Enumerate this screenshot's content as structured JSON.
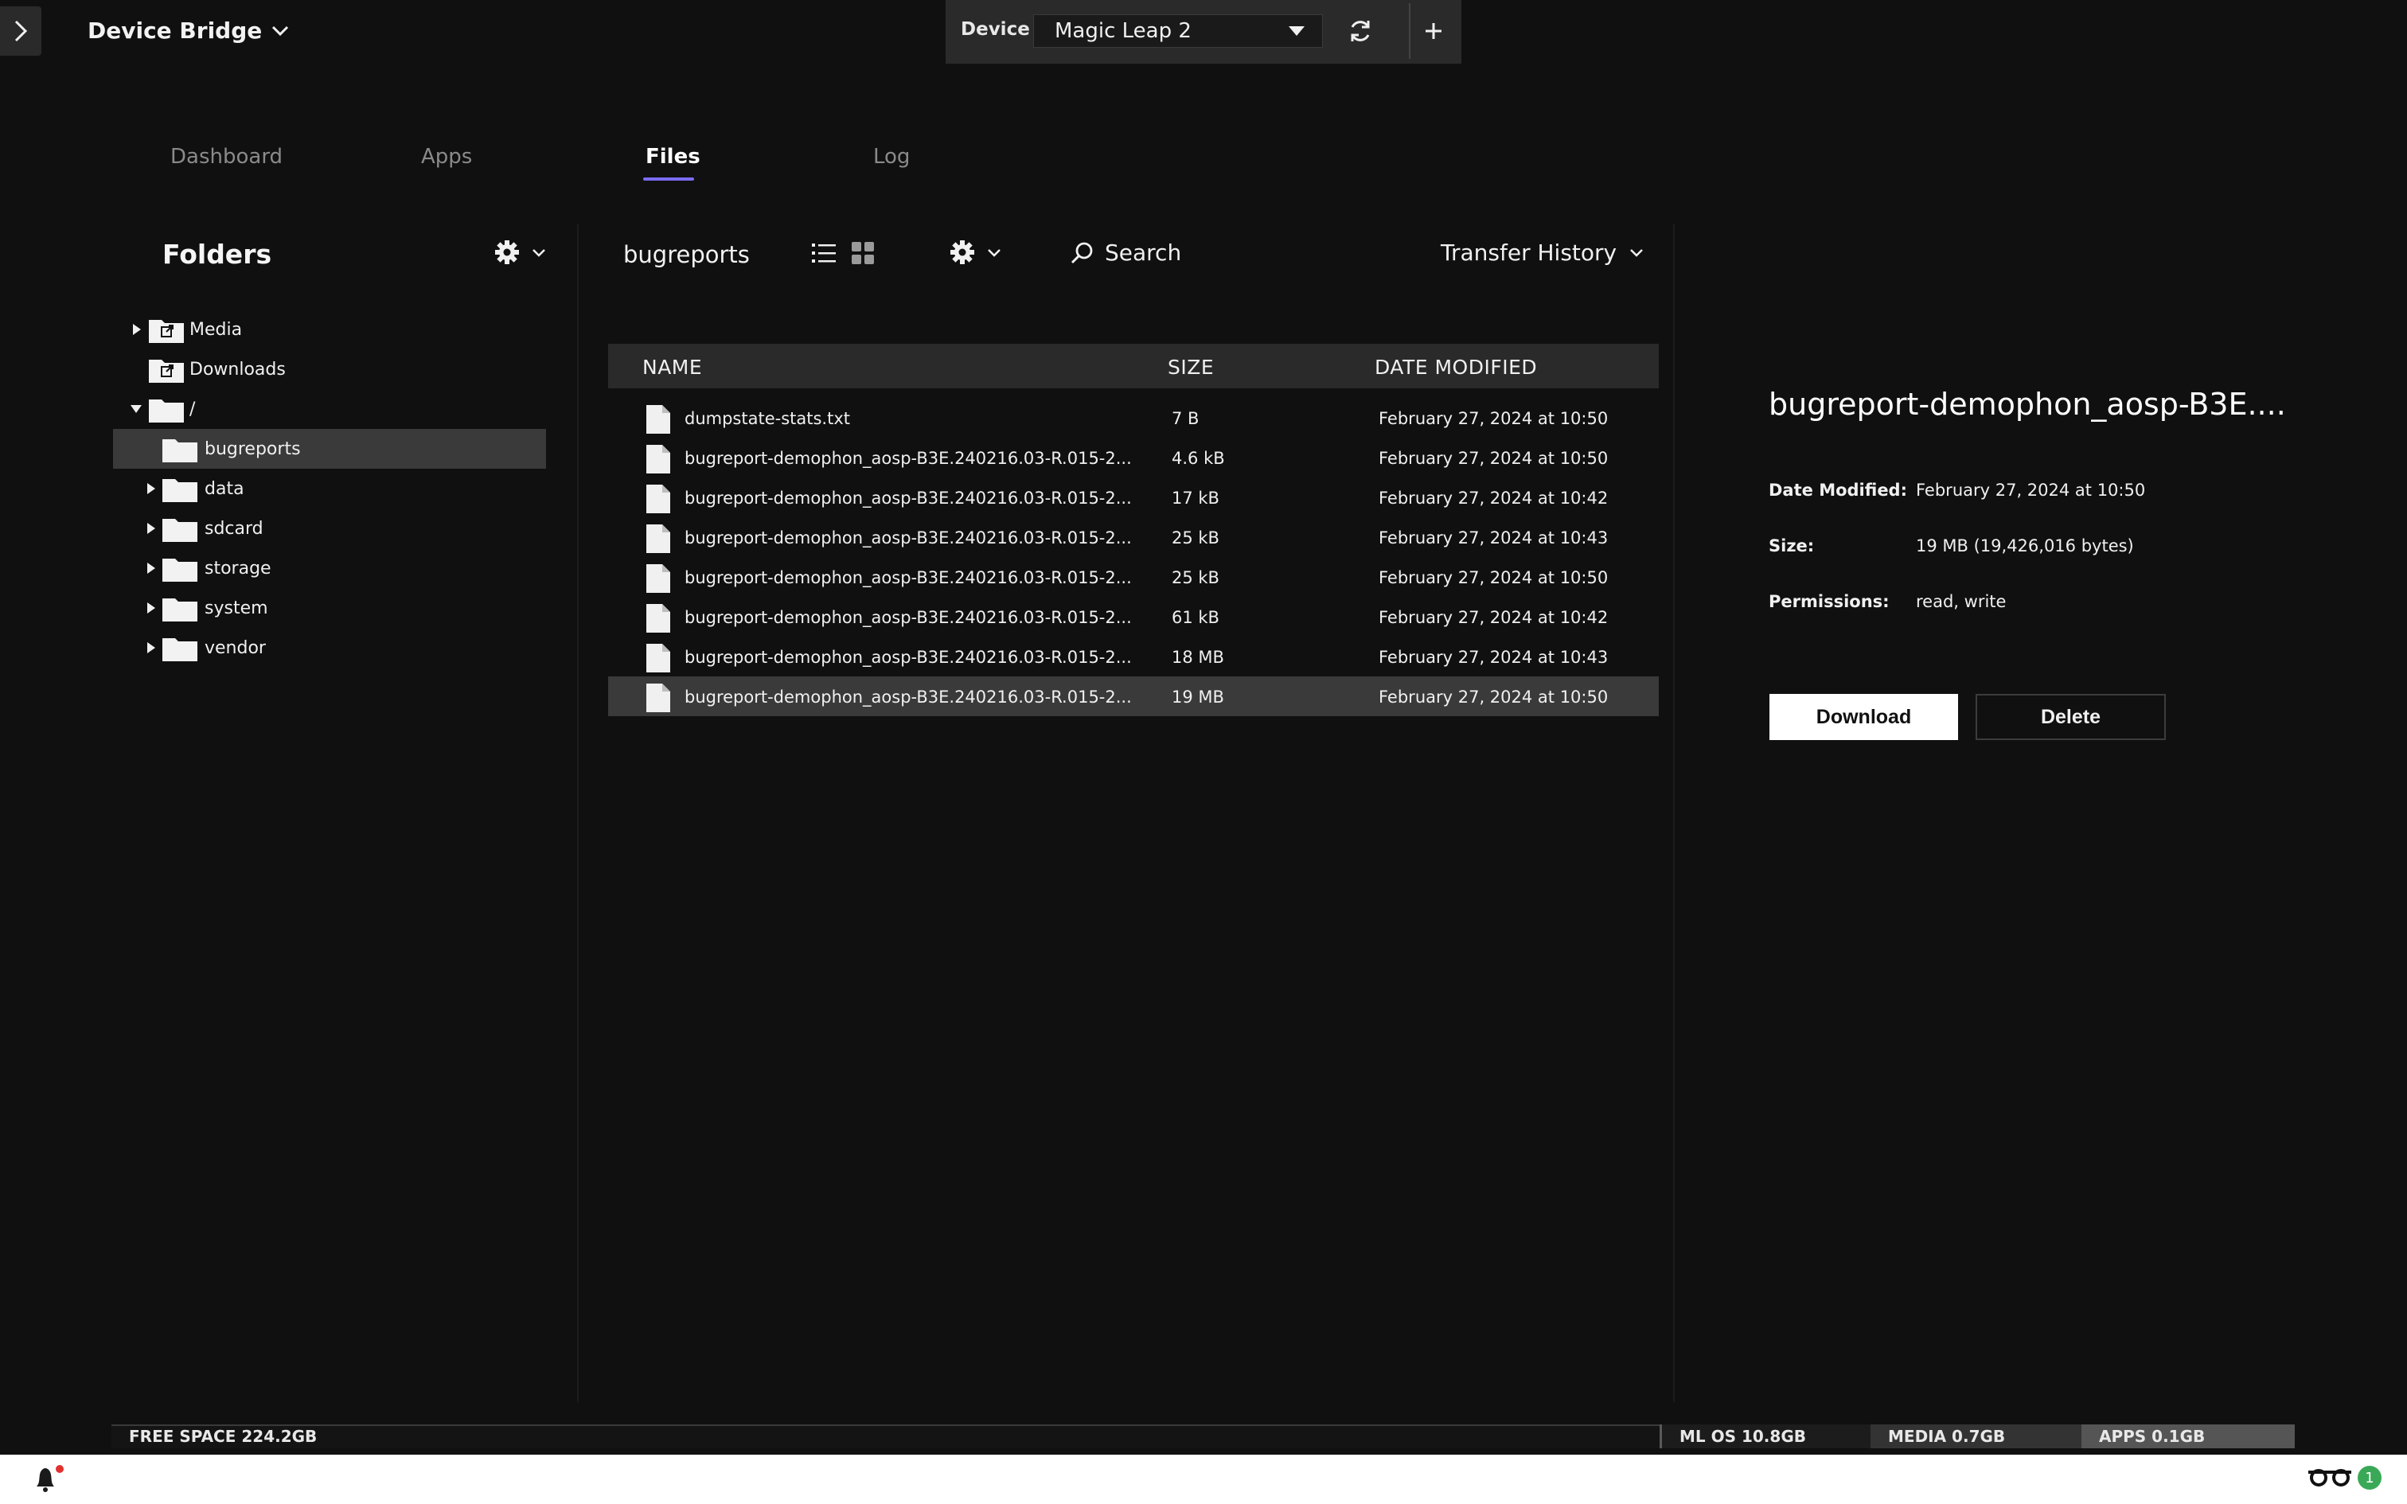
{
  "header": {
    "app_title": "Device Bridge",
    "device_label": "Device",
    "device_selected": "Magic Leap 2"
  },
  "tabs": [
    {
      "label": "Dashboard",
      "active": false
    },
    {
      "label": "Apps",
      "active": false
    },
    {
      "label": "Files",
      "active": true
    },
    {
      "label": "Log",
      "active": false
    }
  ],
  "folders": {
    "heading": "Folders",
    "items": [
      {
        "label": "Media",
        "icon": "linked-folder-icon",
        "expandable": true,
        "expanded": false
      },
      {
        "label": "Downloads",
        "icon": "linked-folder-icon",
        "expandable": false
      },
      {
        "label": "/",
        "icon": "folder-icon",
        "expandable": true,
        "expanded": true
      },
      {
        "label": "bugreports",
        "icon": "folder-icon",
        "expandable": false,
        "selected": true
      },
      {
        "label": "data",
        "icon": "folder-icon",
        "expandable": true
      },
      {
        "label": "sdcard",
        "icon": "folder-icon",
        "expandable": true
      },
      {
        "label": "storage",
        "icon": "folder-icon",
        "expandable": true
      },
      {
        "label": "system",
        "icon": "folder-icon",
        "expandable": true
      },
      {
        "label": "vendor",
        "icon": "folder-icon",
        "expandable": true
      }
    ]
  },
  "files": {
    "current_folder": "bugreports",
    "search_label": "Search",
    "transfer_history_label": "Transfer History",
    "columns": {
      "name": "NAME",
      "size": "SIZE",
      "date": "DATE MODIFIED"
    },
    "rows": [
      {
        "name": "dumpstate-stats.txt",
        "size": "7 B",
        "date": "February 27, 2024 at 10:50"
      },
      {
        "name": "bugreport-demophon_aosp-B3E.240216.03-R.015-2...",
        "size": "4.6 kB",
        "date": "February 27, 2024 at 10:50"
      },
      {
        "name": "bugreport-demophon_aosp-B3E.240216.03-R.015-2...",
        "size": "17 kB",
        "date": "February 27, 2024 at 10:42"
      },
      {
        "name": "bugreport-demophon_aosp-B3E.240216.03-R.015-2...",
        "size": "25 kB",
        "date": "February 27, 2024 at 10:43"
      },
      {
        "name": "bugreport-demophon_aosp-B3E.240216.03-R.015-2...",
        "size": "25 kB",
        "date": "February 27, 2024 at 10:50"
      },
      {
        "name": "bugreport-demophon_aosp-B3E.240216.03-R.015-2...",
        "size": "61 kB",
        "date": "February 27, 2024 at 10:42"
      },
      {
        "name": "bugreport-demophon_aosp-B3E.240216.03-R.015-2...",
        "size": "18 MB",
        "date": "February 27, 2024 at 10:43"
      },
      {
        "name": "bugreport-demophon_aosp-B3E.240216.03-R.015-2...",
        "size": "19 MB",
        "date": "February 27, 2024 at 10:50",
        "selected": true
      }
    ]
  },
  "detail": {
    "title": "bugreport-demophon_aosp-B3E....",
    "date_modified_label": "Date Modified:",
    "date_modified": "February 27, 2024 at 10:50",
    "size_label": "Size:",
    "size": "19 MB (19,426,016 bytes)",
    "permissions_label": "Permissions:",
    "permissions": "read, write",
    "download_label": "Download",
    "delete_label": "Delete"
  },
  "storage": {
    "free_space": "FREE SPACE 224.2GB",
    "ml_os": "ML OS 10.8GB",
    "media": "MEDIA 0.7GB",
    "apps": "APPS 0.1GB"
  },
  "status": {
    "connected_devices": "1"
  },
  "colors": {
    "accent": "#7b6cf6",
    "background": "#101010",
    "selected_row": "#3a3a3a",
    "notification_dot": "#e0322f",
    "badge": "#3aa957"
  }
}
